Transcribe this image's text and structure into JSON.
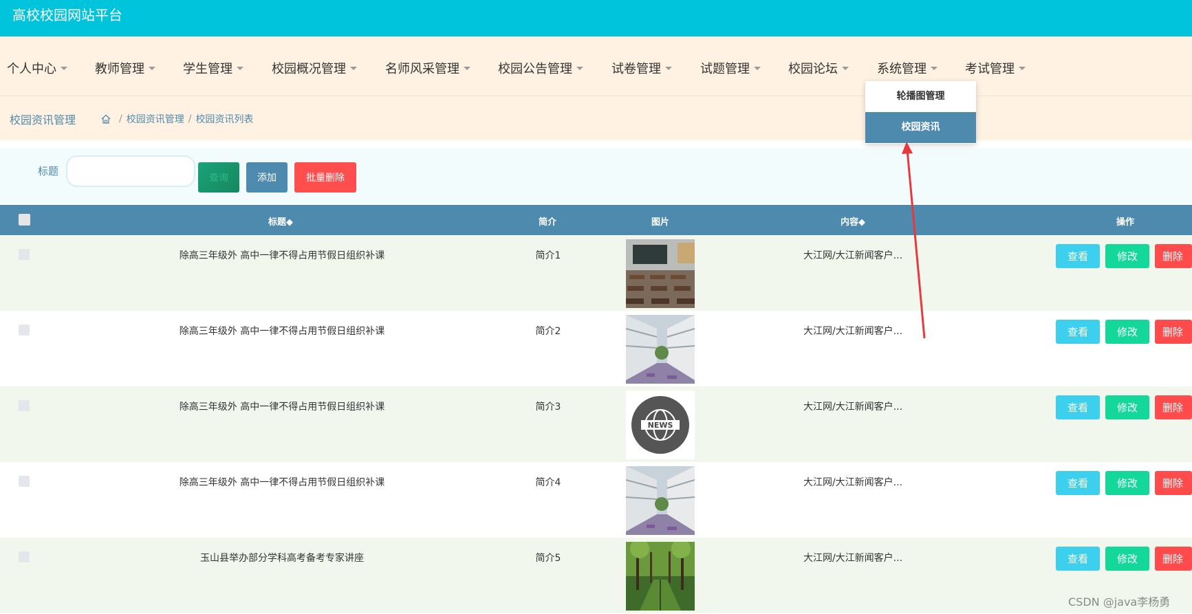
{
  "header": {
    "title": "高校校园网站平台"
  },
  "nav": {
    "items": [
      "个人中心",
      "教师管理",
      "学生管理",
      "校园概况管理",
      "名师风采管理",
      "校园公告管理",
      "试卷管理",
      "试题管理",
      "校园论坛",
      "系统管理",
      "考试管理"
    ]
  },
  "dropdown": {
    "items": [
      "轮播图管理",
      "校园资讯"
    ],
    "active": "校园资讯"
  },
  "breadcrumb": {
    "title": "校园资讯管理",
    "path": [
      "校园资讯管理",
      "校园资讯列表"
    ]
  },
  "search": {
    "label": "标题",
    "value": "",
    "query_label": "查询",
    "add_label": "添加",
    "batch_delete_label": "批量删除"
  },
  "table": {
    "headers": {
      "title": "标题◆",
      "intro": "简介",
      "image": "图片",
      "content": "内容◆",
      "actions": "操作"
    },
    "rows": [
      {
        "title": "除高三年级外 高中一律不得占用节假日组织补课",
        "intro": "简介1",
        "image": "classroom",
        "content": "大江网/大江新闻客户..."
      },
      {
        "title": "除高三年级外 高中一律不得占用节假日组织补课",
        "intro": "简介2",
        "image": "campus-building",
        "content": "大江网/大江新闻客户..."
      },
      {
        "title": "除高三年级外 高中一律不得占用节假日组织补课",
        "intro": "简介3",
        "image": "news-logo",
        "content": "大江网/大江新闻客户..."
      },
      {
        "title": "除高三年级外 高中一律不得占用节假日组织补课",
        "intro": "简介4",
        "image": "campus-building",
        "content": "大江网/大江新闻客户..."
      },
      {
        "title": "玉山县举办部分学科高考备考专家讲座",
        "intro": "简介5",
        "image": "tree-path",
        "content": "大江网/大江新闻客户..."
      }
    ],
    "actions": {
      "view": "查看",
      "edit": "修改",
      "delete": "删除"
    }
  },
  "watermark": "CSDN @java李杨勇",
  "colors": {
    "topbar": "#00c4dc",
    "nav_bg": "#fff2e2",
    "primary": "#4e8aad",
    "view": "#3dcfee",
    "edit": "#13d89a",
    "delete": "#ff4b4b",
    "annotation_arrow": "#e8383d"
  }
}
